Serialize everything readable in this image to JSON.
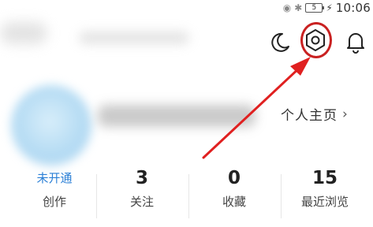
{
  "status_bar": {
    "icons": [
      "eye-icon",
      "bluetooth-icon"
    ],
    "battery_level": "5",
    "charging_glyph": "⚡",
    "time": "10:06"
  },
  "header": {
    "moon_icon": "moon-icon",
    "settings_icon": "settings-hexagon-icon",
    "bell_icon": "bell-icon",
    "highlight_color": "#c92121"
  },
  "profile": {
    "link_label": "个人主页",
    "link_chevron": "›"
  },
  "stats": [
    {
      "value": "未开通",
      "label": "创作"
    },
    {
      "value": "3",
      "label": "关注"
    },
    {
      "value": "0",
      "label": "收藏"
    },
    {
      "value": "15",
      "label": "最近浏览"
    }
  ],
  "colors": {
    "accent_link": "#2a7fd6",
    "arrow": "#e02020"
  }
}
